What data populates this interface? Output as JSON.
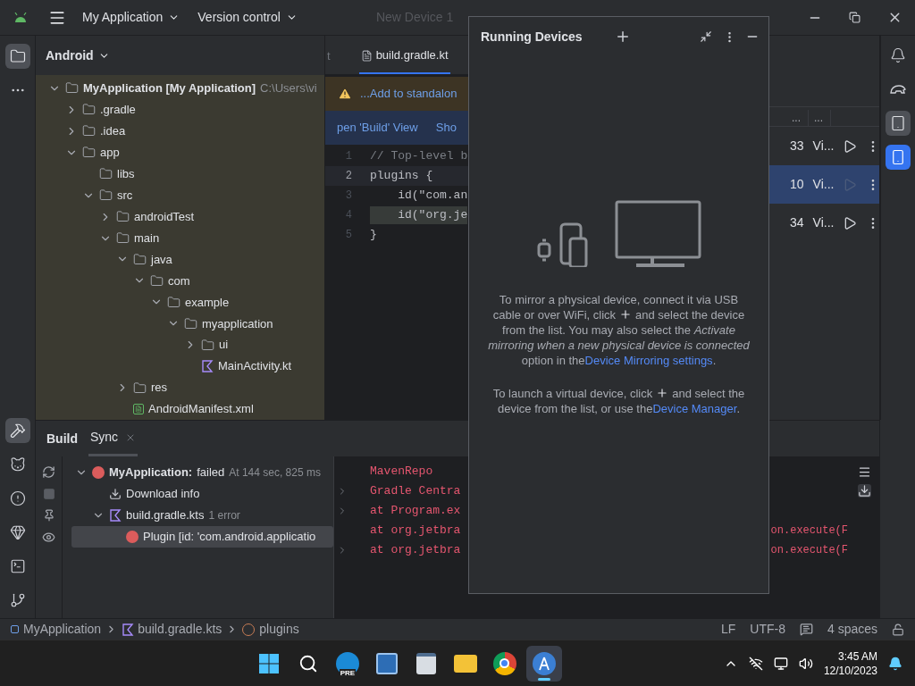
{
  "title_bar": {
    "project": "My Application",
    "vcs": "Version control",
    "run_config": "New Device 1"
  },
  "left_toolbar": {
    "top": [
      {
        "kind": "project",
        "selected": true
      },
      {
        "kind": "more",
        "selected": false
      }
    ],
    "bottom": [
      {
        "kind": "build",
        "selected": true
      },
      {
        "kind": "logcat",
        "selected": false
      },
      {
        "kind": "problems",
        "selected": false
      },
      {
        "kind": "inspection",
        "selected": false
      },
      {
        "kind": "terminal",
        "selected": false
      },
      {
        "kind": "git",
        "selected": false
      }
    ]
  },
  "project_panel": {
    "view": "Android",
    "tree": [
      {
        "kind": "module",
        "label": "MyApplication [My Application]",
        "hint": "C:\\Users\\vi",
        "expanded": true,
        "children": [
          {
            "kind": "folder",
            "label": ".gradle",
            "expanded": false
          },
          {
            "kind": "folder",
            "label": ".idea",
            "expanded": false
          },
          {
            "kind": "folder",
            "label": "app",
            "expanded": true,
            "children": [
              {
                "kind": "folder",
                "label": "libs"
              },
              {
                "kind": "folder",
                "label": "src",
                "expanded": true,
                "children": [
                  {
                    "kind": "folder",
                    "label": "androidTest",
                    "expanded": false
                  },
                  {
                    "kind": "folder",
                    "label": "main",
                    "expanded": true,
                    "children": [
                      {
                        "kind": "folder",
                        "label": "java",
                        "expanded": true,
                        "children": [
                          {
                            "kind": "folder",
                            "label": "com",
                            "expanded": true,
                            "children": [
                              {
                                "kind": "folder",
                                "label": "example",
                                "expanded": true,
                                "children": [
                                  {
                                    "kind": "folder",
                                    "label": "myapplication",
                                    "expanded": true,
                                    "children": [
                                      {
                                        "kind": "folder",
                                        "label": "ui",
                                        "expanded": false
                                      },
                                      {
                                        "kind": "kotlin",
                                        "label": "MainActivity.kt"
                                      }
                                    ]
                                  }
                                ]
                              }
                            ]
                          }
                        ]
                      },
                      {
                        "kind": "folder",
                        "label": "res",
                        "expanded": false
                      },
                      {
                        "kind": "manifest",
                        "label": "AndroidManifest.xml"
                      }
                    ]
                  }
                ]
              }
            ]
          }
        ]
      }
    ]
  },
  "editor": {
    "tabs": [
      {
        "label": "t",
        "selected": false
      },
      {
        "label": "build.gradle.kt",
        "selected": true
      }
    ],
    "warning": "...Add to standalon",
    "actions": [
      "pen 'Build' View",
      "Sho"
    ],
    "code": [
      {
        "number": "1",
        "text": "// Top-level b",
        "kind": "comment",
        "current": false,
        "highlighted": false
      },
      {
        "number": "2",
        "text": "plugins {",
        "kind": "code",
        "current": true,
        "highlighted": false
      },
      {
        "number": "3",
        "text": "    id(\"com.an",
        "kind": "code",
        "current": false,
        "highlighted": false
      },
      {
        "number": "4",
        "text": "    id(\"org.je",
        "kind": "code",
        "current": false,
        "highlighted": true
      },
      {
        "number": "5",
        "text": "}",
        "kind": "code",
        "current": false,
        "highlighted": false
      }
    ]
  },
  "device_manager": {
    "columns": [
      "...",
      "..."
    ],
    "rows": [
      {
        "api": "33",
        "type": "Vi...",
        "selected": false
      },
      {
        "api": "10",
        "type": "Vi...",
        "selected": true
      },
      {
        "api": "34",
        "type": "Vi...",
        "selected": false
      }
    ]
  },
  "right_toolbar": [
    {
      "kind": "notifications",
      "selected": false
    },
    {
      "kind": "gradle",
      "selected": false
    },
    {
      "kind": "device-manager",
      "selected": true
    },
    {
      "kind": "running-devices",
      "selected": true
    }
  ],
  "running_devices": {
    "title": "Running Devices",
    "mirror_text": [
      {
        "kind": "text",
        "text": "To mirror a physical device, connect it via USB cable or over WiFi, click"
      },
      {
        "kind": "plus"
      },
      {
        "kind": "text",
        "text": "and select the device from the list. You may also select the *Activate mirroring when a new physical device is connected* option in the"
      },
      {
        "kind": "link",
        "text": "Device Mirroring settings"
      },
      {
        "kind": "text",
        "text": "."
      }
    ],
    "virtual_text": [
      {
        "kind": "text",
        "text": "To launch a virtual device, click"
      },
      {
        "kind": "plus"
      },
      {
        "kind": "text",
        "text": "and select the device from the list, or use the"
      },
      {
        "kind": "link",
        "text": "Device Manager"
      },
      {
        "kind": "text",
        "text": "."
      }
    ]
  },
  "build_panel": {
    "tabs": [
      {
        "label": "Build",
        "selected": false,
        "closable": false
      },
      {
        "label": "Sync",
        "selected": true,
        "closable": true
      }
    ],
    "tree": [
      {
        "kind": "error",
        "label": "MyApplication:",
        "status": "failed",
        "detail": "At 144 sec, 825 ms",
        "expanded": true,
        "selected": false,
        "children": [
          {
            "kind": "download",
            "label": "Download info",
            "selected": false
          },
          {
            "kind": "kotlin",
            "label": "build.gradle.kts",
            "detail": "1 error",
            "expanded": true,
            "selected": false,
            "children": [
              {
                "kind": "error",
                "label": "Plugin [id: 'com.android.applicatio",
                "selected": true
              }
            ]
          }
        ]
      }
    ],
    "console": [
      {
        "text": "MavenRepo",
        "expandable": false
      },
      {
        "text": "Gradle Centra",
        "expandable": true
      },
      {
        "text": "at Program.ex",
        "expandable": true
      },
      {
        "text": "at org.jetbra",
        "tail": "on.execute(F",
        "expandable": false
      },
      {
        "text": "at org.jetbra",
        "tail": "on.execute(F",
        "expandable": true
      }
    ]
  },
  "status_bar": {
    "breadcrumbs": [
      {
        "kind": "module",
        "label": "MyApplication"
      },
      {
        "kind": "kotlin",
        "label": "build.gradle.kts"
      },
      {
        "kind": "function",
        "label": "plugins"
      }
    ],
    "line_separator": "LF",
    "encoding": "UTF-8",
    "indent": "4 spaces"
  },
  "taskbar": {
    "apps": [
      {
        "kind": "start",
        "selected": false
      },
      {
        "kind": "search",
        "selected": false
      },
      {
        "kind": "edge-beta",
        "badge": "PRE",
        "selected": false
      },
      {
        "kind": "editor",
        "selected": false
      },
      {
        "kind": "notepad",
        "selected": false
      },
      {
        "kind": "explorer",
        "selected": false
      },
      {
        "kind": "chrome",
        "selected": false
      },
      {
        "kind": "android-studio",
        "selected": true
      }
    ],
    "time": "3:45 AM",
    "date": "12/10/2023"
  }
}
